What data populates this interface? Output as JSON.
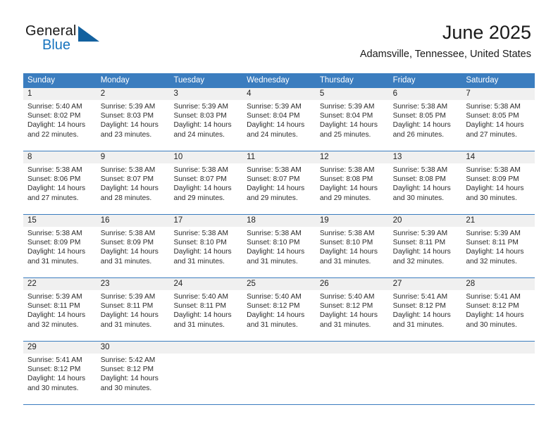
{
  "brand": {
    "name_part1": "General",
    "name_part2": "Blue",
    "logo_icon": "blue-triangle-logo"
  },
  "header": {
    "month_title": "June 2025",
    "location": "Adamsville, Tennessee, United States"
  },
  "colors": {
    "header_blue": "#3b7dbf",
    "brand_blue": "#1673be",
    "date_band": "#f0f0f0",
    "text": "#222222"
  },
  "weekdays": [
    "Sunday",
    "Monday",
    "Tuesday",
    "Wednesday",
    "Thursday",
    "Friday",
    "Saturday"
  ],
  "labels": {
    "sunrise": "Sunrise:",
    "sunset": "Sunset:",
    "daylight": "Daylight:"
  },
  "weeks": [
    [
      {
        "day": "1",
        "sunrise": "Sunrise: 5:40 AM",
        "sunset": "Sunset: 8:02 PM",
        "daylight_l1": "Daylight: 14 hours",
        "daylight_l2": "and 22 minutes."
      },
      {
        "day": "2",
        "sunrise": "Sunrise: 5:39 AM",
        "sunset": "Sunset: 8:03 PM",
        "daylight_l1": "Daylight: 14 hours",
        "daylight_l2": "and 23 minutes."
      },
      {
        "day": "3",
        "sunrise": "Sunrise: 5:39 AM",
        "sunset": "Sunset: 8:03 PM",
        "daylight_l1": "Daylight: 14 hours",
        "daylight_l2": "and 24 minutes."
      },
      {
        "day": "4",
        "sunrise": "Sunrise: 5:39 AM",
        "sunset": "Sunset: 8:04 PM",
        "daylight_l1": "Daylight: 14 hours",
        "daylight_l2": "and 24 minutes."
      },
      {
        "day": "5",
        "sunrise": "Sunrise: 5:39 AM",
        "sunset": "Sunset: 8:04 PM",
        "daylight_l1": "Daylight: 14 hours",
        "daylight_l2": "and 25 minutes."
      },
      {
        "day": "6",
        "sunrise": "Sunrise: 5:38 AM",
        "sunset": "Sunset: 8:05 PM",
        "daylight_l1": "Daylight: 14 hours",
        "daylight_l2": "and 26 minutes."
      },
      {
        "day": "7",
        "sunrise": "Sunrise: 5:38 AM",
        "sunset": "Sunset: 8:05 PM",
        "daylight_l1": "Daylight: 14 hours",
        "daylight_l2": "and 27 minutes."
      }
    ],
    [
      {
        "day": "8",
        "sunrise": "Sunrise: 5:38 AM",
        "sunset": "Sunset: 8:06 PM",
        "daylight_l1": "Daylight: 14 hours",
        "daylight_l2": "and 27 minutes."
      },
      {
        "day": "9",
        "sunrise": "Sunrise: 5:38 AM",
        "sunset": "Sunset: 8:07 PM",
        "daylight_l1": "Daylight: 14 hours",
        "daylight_l2": "and 28 minutes."
      },
      {
        "day": "10",
        "sunrise": "Sunrise: 5:38 AM",
        "sunset": "Sunset: 8:07 PM",
        "daylight_l1": "Daylight: 14 hours",
        "daylight_l2": "and 29 minutes."
      },
      {
        "day": "11",
        "sunrise": "Sunrise: 5:38 AM",
        "sunset": "Sunset: 8:07 PM",
        "daylight_l1": "Daylight: 14 hours",
        "daylight_l2": "and 29 minutes."
      },
      {
        "day": "12",
        "sunrise": "Sunrise: 5:38 AM",
        "sunset": "Sunset: 8:08 PM",
        "daylight_l1": "Daylight: 14 hours",
        "daylight_l2": "and 29 minutes."
      },
      {
        "day": "13",
        "sunrise": "Sunrise: 5:38 AM",
        "sunset": "Sunset: 8:08 PM",
        "daylight_l1": "Daylight: 14 hours",
        "daylight_l2": "and 30 minutes."
      },
      {
        "day": "14",
        "sunrise": "Sunrise: 5:38 AM",
        "sunset": "Sunset: 8:09 PM",
        "daylight_l1": "Daylight: 14 hours",
        "daylight_l2": "and 30 minutes."
      }
    ],
    [
      {
        "day": "15",
        "sunrise": "Sunrise: 5:38 AM",
        "sunset": "Sunset: 8:09 PM",
        "daylight_l1": "Daylight: 14 hours",
        "daylight_l2": "and 31 minutes."
      },
      {
        "day": "16",
        "sunrise": "Sunrise: 5:38 AM",
        "sunset": "Sunset: 8:09 PM",
        "daylight_l1": "Daylight: 14 hours",
        "daylight_l2": "and 31 minutes."
      },
      {
        "day": "17",
        "sunrise": "Sunrise: 5:38 AM",
        "sunset": "Sunset: 8:10 PM",
        "daylight_l1": "Daylight: 14 hours",
        "daylight_l2": "and 31 minutes."
      },
      {
        "day": "18",
        "sunrise": "Sunrise: 5:38 AM",
        "sunset": "Sunset: 8:10 PM",
        "daylight_l1": "Daylight: 14 hours",
        "daylight_l2": "and 31 minutes."
      },
      {
        "day": "19",
        "sunrise": "Sunrise: 5:38 AM",
        "sunset": "Sunset: 8:10 PM",
        "daylight_l1": "Daylight: 14 hours",
        "daylight_l2": "and 31 minutes."
      },
      {
        "day": "20",
        "sunrise": "Sunrise: 5:39 AM",
        "sunset": "Sunset: 8:11 PM",
        "daylight_l1": "Daylight: 14 hours",
        "daylight_l2": "and 32 minutes."
      },
      {
        "day": "21",
        "sunrise": "Sunrise: 5:39 AM",
        "sunset": "Sunset: 8:11 PM",
        "daylight_l1": "Daylight: 14 hours",
        "daylight_l2": "and 32 minutes."
      }
    ],
    [
      {
        "day": "22",
        "sunrise": "Sunrise: 5:39 AM",
        "sunset": "Sunset: 8:11 PM",
        "daylight_l1": "Daylight: 14 hours",
        "daylight_l2": "and 32 minutes."
      },
      {
        "day": "23",
        "sunrise": "Sunrise: 5:39 AM",
        "sunset": "Sunset: 8:11 PM",
        "daylight_l1": "Daylight: 14 hours",
        "daylight_l2": "and 31 minutes."
      },
      {
        "day": "24",
        "sunrise": "Sunrise: 5:40 AM",
        "sunset": "Sunset: 8:11 PM",
        "daylight_l1": "Daylight: 14 hours",
        "daylight_l2": "and 31 minutes."
      },
      {
        "day": "25",
        "sunrise": "Sunrise: 5:40 AM",
        "sunset": "Sunset: 8:12 PM",
        "daylight_l1": "Daylight: 14 hours",
        "daylight_l2": "and 31 minutes."
      },
      {
        "day": "26",
        "sunrise": "Sunrise: 5:40 AM",
        "sunset": "Sunset: 8:12 PM",
        "daylight_l1": "Daylight: 14 hours",
        "daylight_l2": "and 31 minutes."
      },
      {
        "day": "27",
        "sunrise": "Sunrise: 5:41 AM",
        "sunset": "Sunset: 8:12 PM",
        "daylight_l1": "Daylight: 14 hours",
        "daylight_l2": "and 31 minutes."
      },
      {
        "day": "28",
        "sunrise": "Sunrise: 5:41 AM",
        "sunset": "Sunset: 8:12 PM",
        "daylight_l1": "Daylight: 14 hours",
        "daylight_l2": "and 30 minutes."
      }
    ],
    [
      {
        "day": "29",
        "sunrise": "Sunrise: 5:41 AM",
        "sunset": "Sunset: 8:12 PM",
        "daylight_l1": "Daylight: 14 hours",
        "daylight_l2": "and 30 minutes."
      },
      {
        "day": "30",
        "sunrise": "Sunrise: 5:42 AM",
        "sunset": "Sunset: 8:12 PM",
        "daylight_l1": "Daylight: 14 hours",
        "daylight_l2": "and 30 minutes."
      },
      {
        "day": "",
        "sunrise": "",
        "sunset": "",
        "daylight_l1": "",
        "daylight_l2": ""
      },
      {
        "day": "",
        "sunrise": "",
        "sunset": "",
        "daylight_l1": "",
        "daylight_l2": ""
      },
      {
        "day": "",
        "sunrise": "",
        "sunset": "",
        "daylight_l1": "",
        "daylight_l2": ""
      },
      {
        "day": "",
        "sunrise": "",
        "sunset": "",
        "daylight_l1": "",
        "daylight_l2": ""
      },
      {
        "day": "",
        "sunrise": "",
        "sunset": "",
        "daylight_l1": "",
        "daylight_l2": ""
      }
    ]
  ]
}
